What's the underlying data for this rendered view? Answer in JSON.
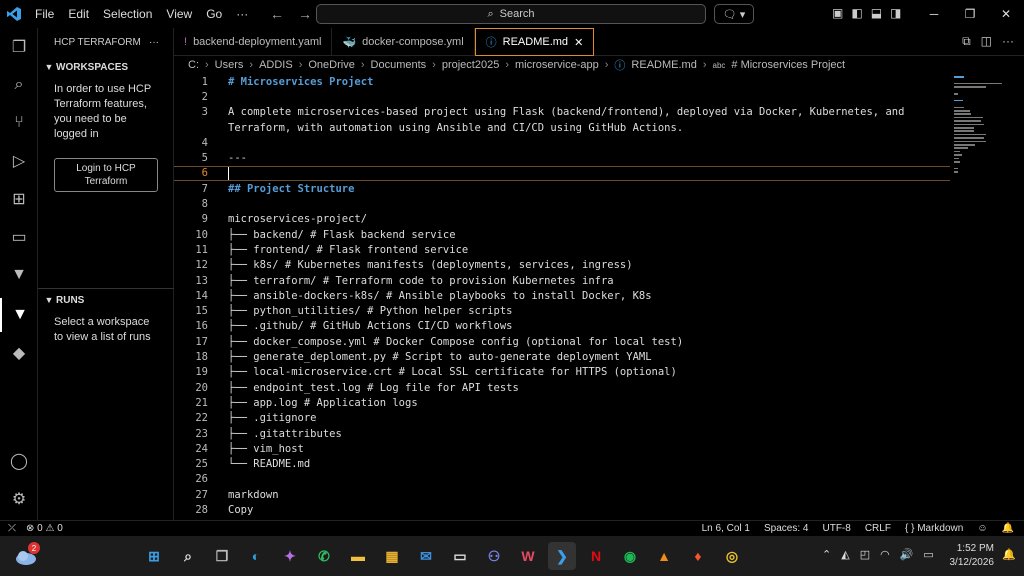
{
  "menu": [
    "File",
    "Edit",
    "Selection",
    "View",
    "Go",
    "···"
  ],
  "search": {
    "label": "Search"
  },
  "sidebar": {
    "title": "HCP TERRAFORM",
    "more": "···",
    "workspaces_title": "WORKSPACES",
    "workspaces_text": "In order to use HCP Terraform features, you need to be logged in",
    "login_button": "Login to HCP Terraform",
    "runs_title": "RUNS",
    "runs_text": "Select a workspace to view a list of runs"
  },
  "tabs": [
    {
      "label": "backend-deployment.yaml",
      "icon": "!",
      "color": "#c060c0"
    },
    {
      "label": "docker-compose.yml",
      "icon": "🐳",
      "color": "#3b9fe8"
    },
    {
      "label": "README.md",
      "icon": "ⓘ",
      "color": "#3b9fe8",
      "active": true
    }
  ],
  "breadcrumb": [
    "C:",
    "Users",
    "ADDIS",
    "OneDrive",
    "Documents",
    "project2025",
    "microservice-app",
    "README.md",
    "# Microservices Project"
  ],
  "editor": {
    "lines": [
      {
        "n": "1",
        "text": "# Microservices Project",
        "heading": true
      },
      {
        "n": "2",
        "text": ""
      },
      {
        "n": "3",
        "text": "A complete microservices-based project using Flask (backend/frontend), deployed via Docker, Kubernetes, and"
      },
      {
        "n": "",
        "text": "Terraform, with automation using Ansible and CI/CD using GitHub Actions."
      },
      {
        "n": "4",
        "text": ""
      },
      {
        "n": "5",
        "text": "---"
      },
      {
        "n": "6",
        "text": "",
        "current": true
      },
      {
        "n": "7",
        "text": "## Project Structure",
        "heading": true
      },
      {
        "n": "8",
        "text": ""
      },
      {
        "n": "9",
        "text": "microservices-project/"
      },
      {
        "n": "10",
        "text": "├── backend/ # Flask backend service"
      },
      {
        "n": "11",
        "text": "├── frontend/ # Flask frontend service"
      },
      {
        "n": "12",
        "text": "├── k8s/ # Kubernetes manifests (deployments, services, ingress)"
      },
      {
        "n": "13",
        "text": "├── terraform/ # Terraform code to provision Kubernetes infra"
      },
      {
        "n": "14",
        "text": "├── ansible-dockers-k8s/ # Ansible playbooks to install Docker, K8s"
      },
      {
        "n": "15",
        "text": "├── python_utilities/ # Python helper scripts"
      },
      {
        "n": "16",
        "text": "├── .github/ # GitHub Actions CI/CD workflows"
      },
      {
        "n": "17",
        "text": "├── docker_compose.yml # Docker Compose config (optional for local test)"
      },
      {
        "n": "18",
        "text": "├── generate_deploment.py # Script to auto-generate deployment YAML"
      },
      {
        "n": "19",
        "text": "├── local-microservice.crt # Local SSL certificate for HTTPS (optional)"
      },
      {
        "n": "20",
        "text": "├── endpoint_test.log # Log file for API tests"
      },
      {
        "n": "21",
        "text": "├── app.log # Application logs"
      },
      {
        "n": "22",
        "text": "├── .gitignore"
      },
      {
        "n": "23",
        "text": "├── .gitattributes"
      },
      {
        "n": "24",
        "text": "├── vim_host"
      },
      {
        "n": "25",
        "text": "└── README.md"
      },
      {
        "n": "26",
        "text": ""
      },
      {
        "n": "27",
        "text": "markdown"
      },
      {
        "n": "28",
        "text": "Copy"
      }
    ]
  },
  "status": {
    "problems": "⊗ 0 ⚠ 0",
    "position": "Ln 6, Col 1",
    "spaces": "Spaces: 4",
    "encoding": "UTF-8",
    "eol": "CRLF",
    "language": "{ } Markdown"
  },
  "taskbar": {
    "weather_badge": "2",
    "time": "1:52 PM",
    "date": "3/12/2026"
  }
}
